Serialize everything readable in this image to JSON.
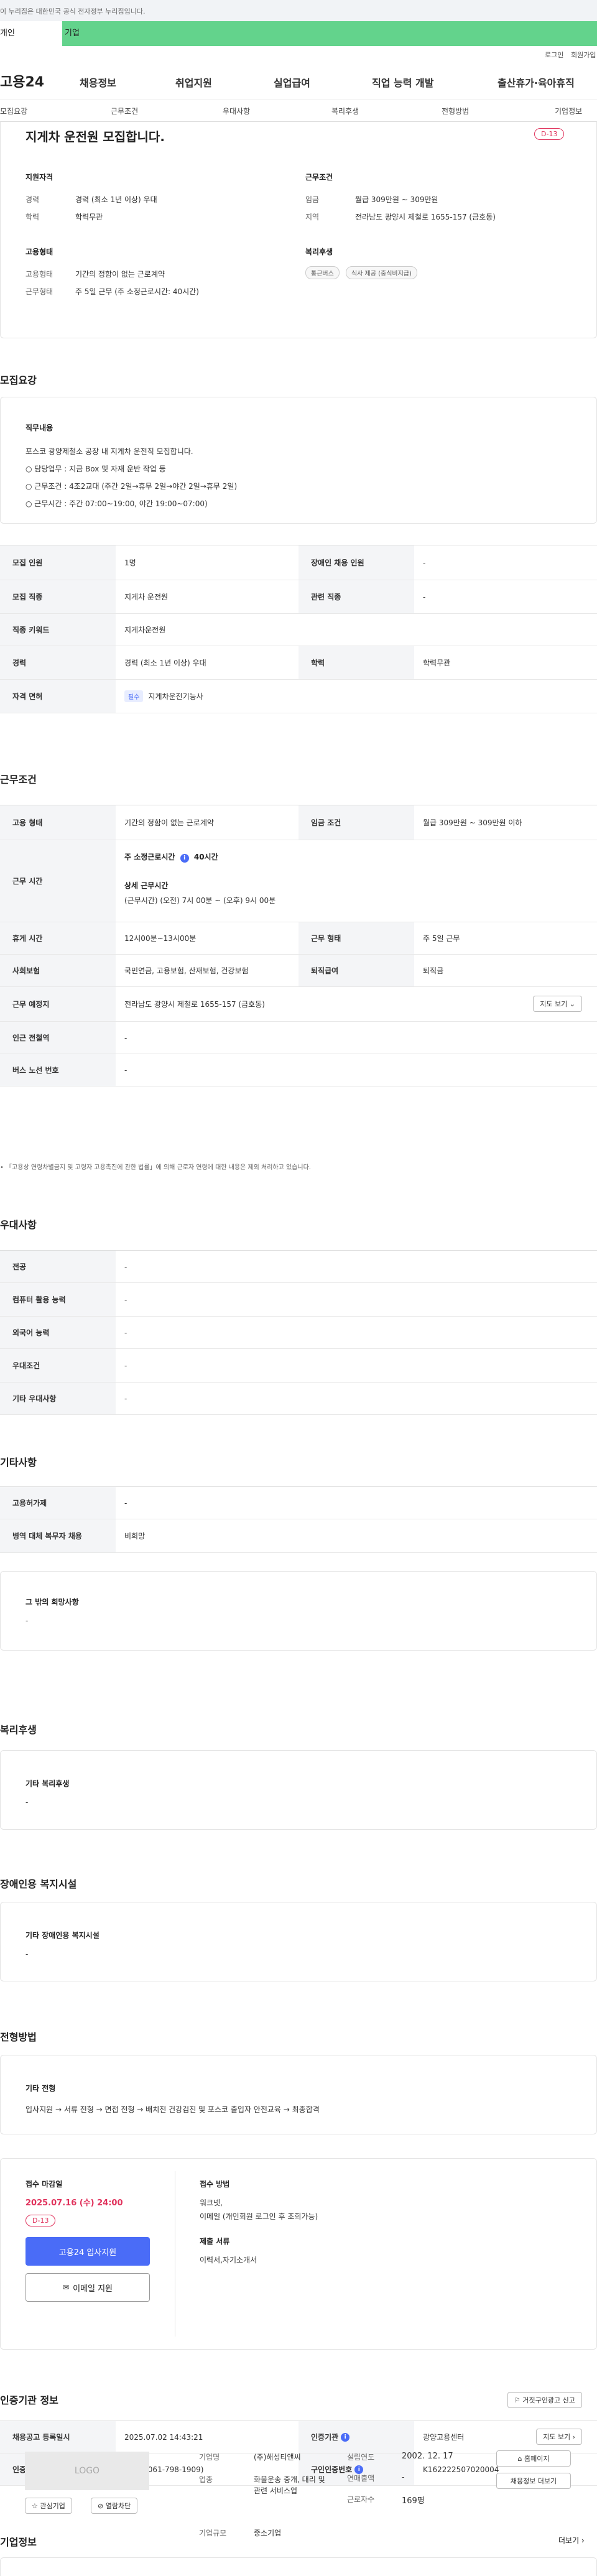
{
  "gov_bar": {
    "text": "이 누리집은 대한민국 공식 전자정부 누리집입니다."
  },
  "site_tabs": {
    "personal": "개인",
    "business": "기업"
  },
  "util_links": {
    "login": "로그인",
    "join": "회원가입"
  },
  "gnb": {
    "logo": "고용24",
    "items": [
      "채용정보",
      "취업지원",
      "실업급여",
      "직업 능력 개발",
      "출산휴가·육아휴직"
    ]
  },
  "lnb": {
    "items": [
      "모집요강",
      "근무조건",
      "우대사항",
      "복리후생",
      "전형방법",
      "기업정보"
    ]
  },
  "summary": {
    "title": "지게차 운전원 모집합니다.",
    "dday": "D-13",
    "qual_head": "지원자격",
    "career_lbl": "경력",
    "career_val": "경력 (최소 1년 이상) 우대",
    "edu_lbl": "학력",
    "edu_val": "학력무관",
    "cond_head": "근무조건",
    "wage_lbl": "임금",
    "wage_val": "월급 309만원 ~ 309만원",
    "loc_lbl": "지역",
    "loc_val": "전라남도 광양시 제철로 1655-157 (금호동)",
    "emp_head": "고용형태",
    "type_lbl": "고용형태",
    "type_val": "기간의 정함이 없는 근로계약",
    "form_lbl": "근무형태",
    "form_val": "주 5일 근무 (주 소정근로시간: 40시간)",
    "welfare_head": "복리후생",
    "welfare_tags": [
      "통근버스",
      "식사 제공 (중식비지급)"
    ]
  },
  "recruit": {
    "heading": "모집요강",
    "duty_head": "직무내용",
    "duty_lines": [
      "포스코 광양제철소 공장 내 지게차 운전직 모집합니다.",
      "○ 담당업무 : 지금 Box 및 자재 운반 작업 등",
      "○ 근무조건 : 4조2교대 (주간 2일→휴무 2일→야간 2일→휴무 2일)",
      "○ 근무시간 : 주간 07:00~19:00, 야간 19:00~07:00)"
    ],
    "rows": [
      {
        "th": "모집 인원",
        "td": "1명",
        "th2": "장애인 채용 인원",
        "td2": "-"
      },
      {
        "th": "모집 직종",
        "td": "지게차 운전원",
        "th2": "관련 직종",
        "td2": "-"
      },
      {
        "th": "직종 키워드",
        "td": "지게차운전원"
      },
      {
        "th": "경력",
        "td": "경력 (최소 1년 이상) 우대",
        "th2": "학력",
        "td2": "학력무관"
      },
      {
        "th": "자격 면허",
        "badge": "필수",
        "td": "지게차운전기능사"
      }
    ]
  },
  "work": {
    "heading": "근무조건",
    "row1": {
      "th": "고용 형태",
      "td": "기간의 정함이 없는 근로계약",
      "th2": "임금 조건",
      "td2": "월급 309만원 ~ 309만원 이하"
    },
    "hours": {
      "th": "근무 시간",
      "weekly": "주 소정근로시간",
      "weekly_val": "40시간",
      "detail_head": "상세 근무시간",
      "detail_val": "(근무시간) (오전) 7시 00분 ~ (오후) 9시 00분"
    },
    "row3": {
      "th": "휴게 시간",
      "td": "12시00분~13시00분",
      "th2": "근무 형태",
      "td2": "주 5일 근무"
    },
    "row4": {
      "th": "사회보험",
      "td": "국민연금, 고용보험, 산재보험, 건강보험",
      "th2": "퇴직급여",
      "td2": "퇴직금"
    },
    "row5": {
      "th": "근무 예정지",
      "td": "전라남도 광양시 제철로 1655-157 (금호동)",
      "btn": "지도 보기"
    },
    "row6": {
      "th": "인근 전철역",
      "td": "-"
    },
    "row7": {
      "th": "버스 노선 번호",
      "td": "-"
    },
    "note": "「고용상 연령차별금지 및 고령자 고용촉진에 관한 법률」에 의해 근로자 연령에 대한 내용은 제외 처리하고 있습니다."
  },
  "pref": {
    "heading": "우대사항",
    "rows": [
      {
        "th": "전공",
        "td": "-"
      },
      {
        "th": "컴퓨터 활용 능력",
        "td": "-"
      },
      {
        "th": "외국어 능력",
        "td": "-"
      },
      {
        "th": "우대조건",
        "td": "-"
      },
      {
        "th": "기타 우대사항",
        "td": "-"
      }
    ]
  },
  "etc": {
    "heading": "기타사항",
    "rows": [
      {
        "th": "고용허가제",
        "td": "-"
      },
      {
        "th": "병역 대체 복무자 채용",
        "td": "비희망"
      }
    ],
    "card_head": "그 밖의 희망사항",
    "card_val": "-"
  },
  "welfare": {
    "heading": "복리후생",
    "card_head": "기타 복리후생",
    "card_val": "-"
  },
  "disability": {
    "heading": "장애인용 복지시설",
    "card_head": "기타 장애인용 복지시설",
    "card_val": "-"
  },
  "process": {
    "heading": "전형방법",
    "card_head": "기타 전형",
    "card_val": "입사지원 → 서류 전형 → 면접 전형 → 배치전 건강검진 및 포스코 출입자 안전교육 → 최종합격"
  },
  "apply": {
    "deadline_head": "접수 마감일",
    "deadline": "2025.07.16 (수) 24:00",
    "dday": "D-13",
    "apply_btn": "고용24 입사지원",
    "email_btn": "이메일 지원",
    "method_head": "접수 방법",
    "method_val1": "워크넷,",
    "method_val2": "이메일 (개인회원 로그인 후 조회가능)",
    "docs_head": "제출 서류",
    "docs_val": "이력서,자기소개서"
  },
  "agency": {
    "heading": "인증기관 정보",
    "report_btn": "거짓구인광고 신고",
    "rows": [
      {
        "th": "채용공고 등록일시",
        "td": "2025.07.02 14:43:21",
        "th2": "인증기관",
        "td2": "광양고용센터",
        "btn": "지도 보기"
      },
      {
        "th": "인증기관 담당자",
        "td": "이혜진(061-798-1909)",
        "th2": "구인인증번호",
        "td2": "K162222507020004"
      }
    ]
  },
  "company": {
    "heading": "기업정보",
    "more": "더보기",
    "logo_text": "LOGO",
    "interest_btn": "관심기업",
    "block_btn": "열람차단",
    "name_lbl": "기업명",
    "name_val": "(주)해성티앤씨",
    "biz_lbl": "업종",
    "biz_val": "화물운송 중개, 대리 및 관련 서비스업",
    "size_lbl": "기업규모",
    "size_val": "중소기업",
    "year_lbl": "설립연도",
    "year_val": "2002. 12. 17",
    "sales_lbl": "연매출액",
    "sales_val": "-",
    "emp_lbl": "근로자수",
    "emp_val": "169명",
    "home_btn": "홈페이지",
    "jobs_btn": "채용정보 더보기"
  },
  "colors": {
    "accent": "#4a6cf7",
    "green": "#63d38c",
    "red": "#e0315b"
  }
}
